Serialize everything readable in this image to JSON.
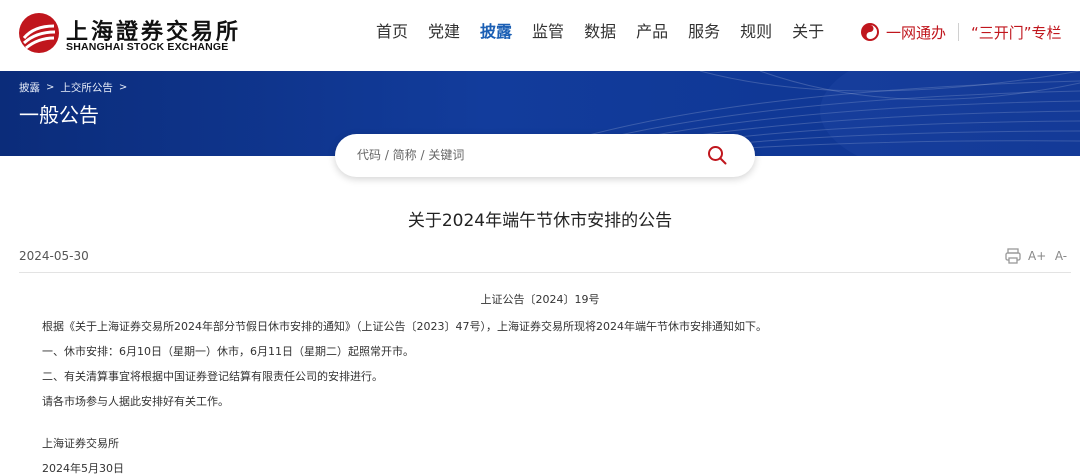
{
  "header": {
    "logo_cn": "上海證券交易所",
    "logo_en": "SHANGHAI STOCK EXCHANGE",
    "nav": [
      {
        "label": "首页",
        "active": false
      },
      {
        "label": "党建",
        "active": false
      },
      {
        "label": "披露",
        "active": true
      },
      {
        "label": "监管",
        "active": false
      },
      {
        "label": "数据",
        "active": false
      },
      {
        "label": "产品",
        "active": false
      },
      {
        "label": "服务",
        "active": false
      },
      {
        "label": "规则",
        "active": false
      },
      {
        "label": "关于",
        "active": false
      }
    ],
    "quick_links": {
      "one_network": "一网通办",
      "three_open": "“三开门”专栏"
    }
  },
  "banner": {
    "breadcrumb": [
      "披露",
      "上交所公告"
    ],
    "title": "一般公告"
  },
  "search": {
    "placeholder": "代码 / 简称 / 关键词",
    "value": ""
  },
  "article": {
    "title": "关于2024年端午节休市安排的公告",
    "date": "2024-05-30",
    "tools": {
      "print_icon": "print-icon",
      "font_larger": "A+",
      "font_smaller": "A-"
    },
    "doc_number": "上证公告〔2024〕19号",
    "paragraphs": [
      "根据《关于上海证券交易所2024年部分节假日休市安排的通知》（上证公告〔2023〕47号），上海证券交易所现将2024年端午节休市安排通知如下。",
      "一、休市安排：6月10日（星期一）休市，6月11日（星期二）起照常开市。",
      "二、有关清算事宜将根据中国证券登记结算有限责任公司的安排进行。",
      "请各市场参与人据此安排好有关工作。"
    ],
    "signature": "上海证券交易所",
    "sign_date": "2024年5月30日"
  },
  "colors": {
    "brand_red": "#c0161d",
    "nav_active": "#1b5fb4",
    "banner_blue": "#123c9c"
  }
}
